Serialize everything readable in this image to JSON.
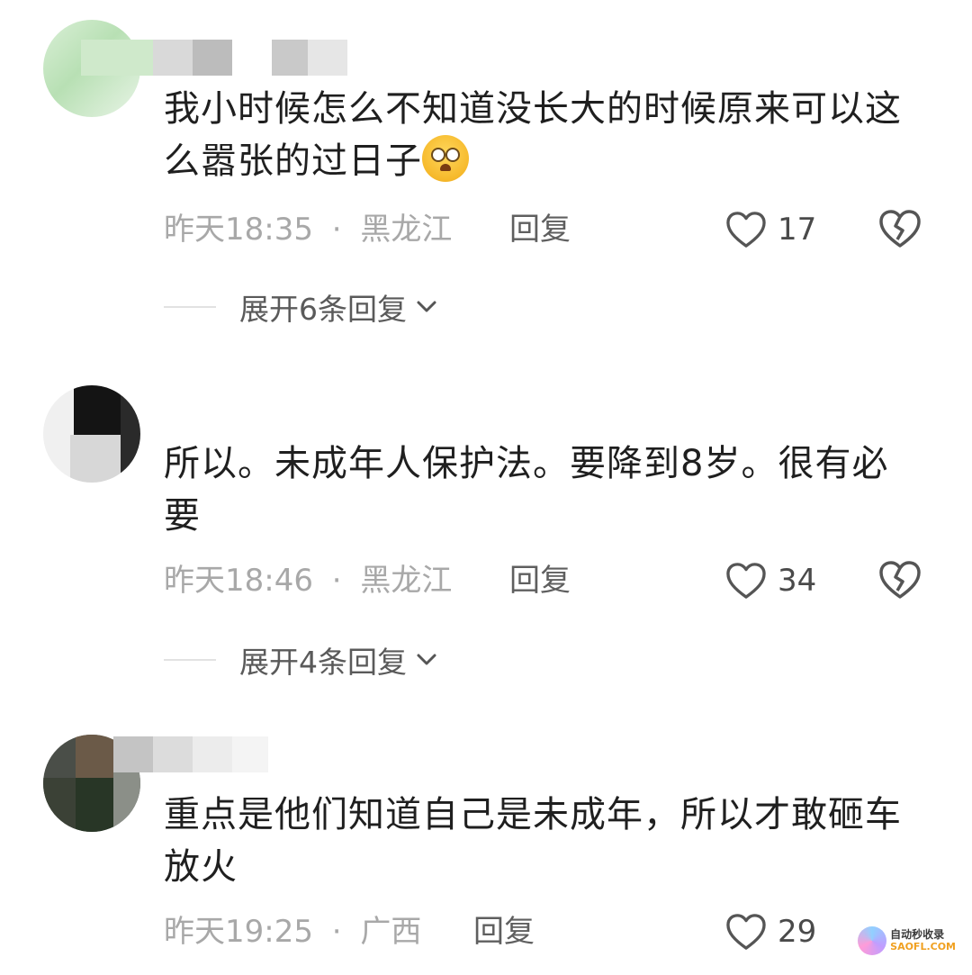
{
  "comments": [
    {
      "text": "我小时候怎么不知道没长大的时候原来可以这么嚣张的过日子",
      "emoji": "crying-face-emoji",
      "time": "昨天18:35",
      "separator": "·",
      "location": "黑龙江",
      "reply_label": "回复",
      "likes": "17",
      "expand_label": "展开6条回复"
    },
    {
      "text": "所以。未成年人保护法。要降到8岁。很有必要",
      "time": "昨天18:46",
      "separator": "·",
      "location": "黑龙江",
      "reply_label": "回复",
      "likes": "34",
      "expand_label": "展开4条回复"
    },
    {
      "text": "重点是他们知道自己是未成年，所以才敢砸车放火",
      "time": "昨天19:25",
      "separator": "·",
      "location": "广西",
      "reply_label": "回复",
      "likes": "29"
    }
  ],
  "icons": {
    "like": "heart-outline-icon",
    "dislike": "broken-heart-icon",
    "expand": "chevron-down-icon"
  },
  "watermark": {
    "line1": "自动秒收录",
    "line2": "SAOFL.COM"
  },
  "colors": {
    "text": "#1f1f1f",
    "meta": "#a8a8a8",
    "icon": "#555555"
  }
}
